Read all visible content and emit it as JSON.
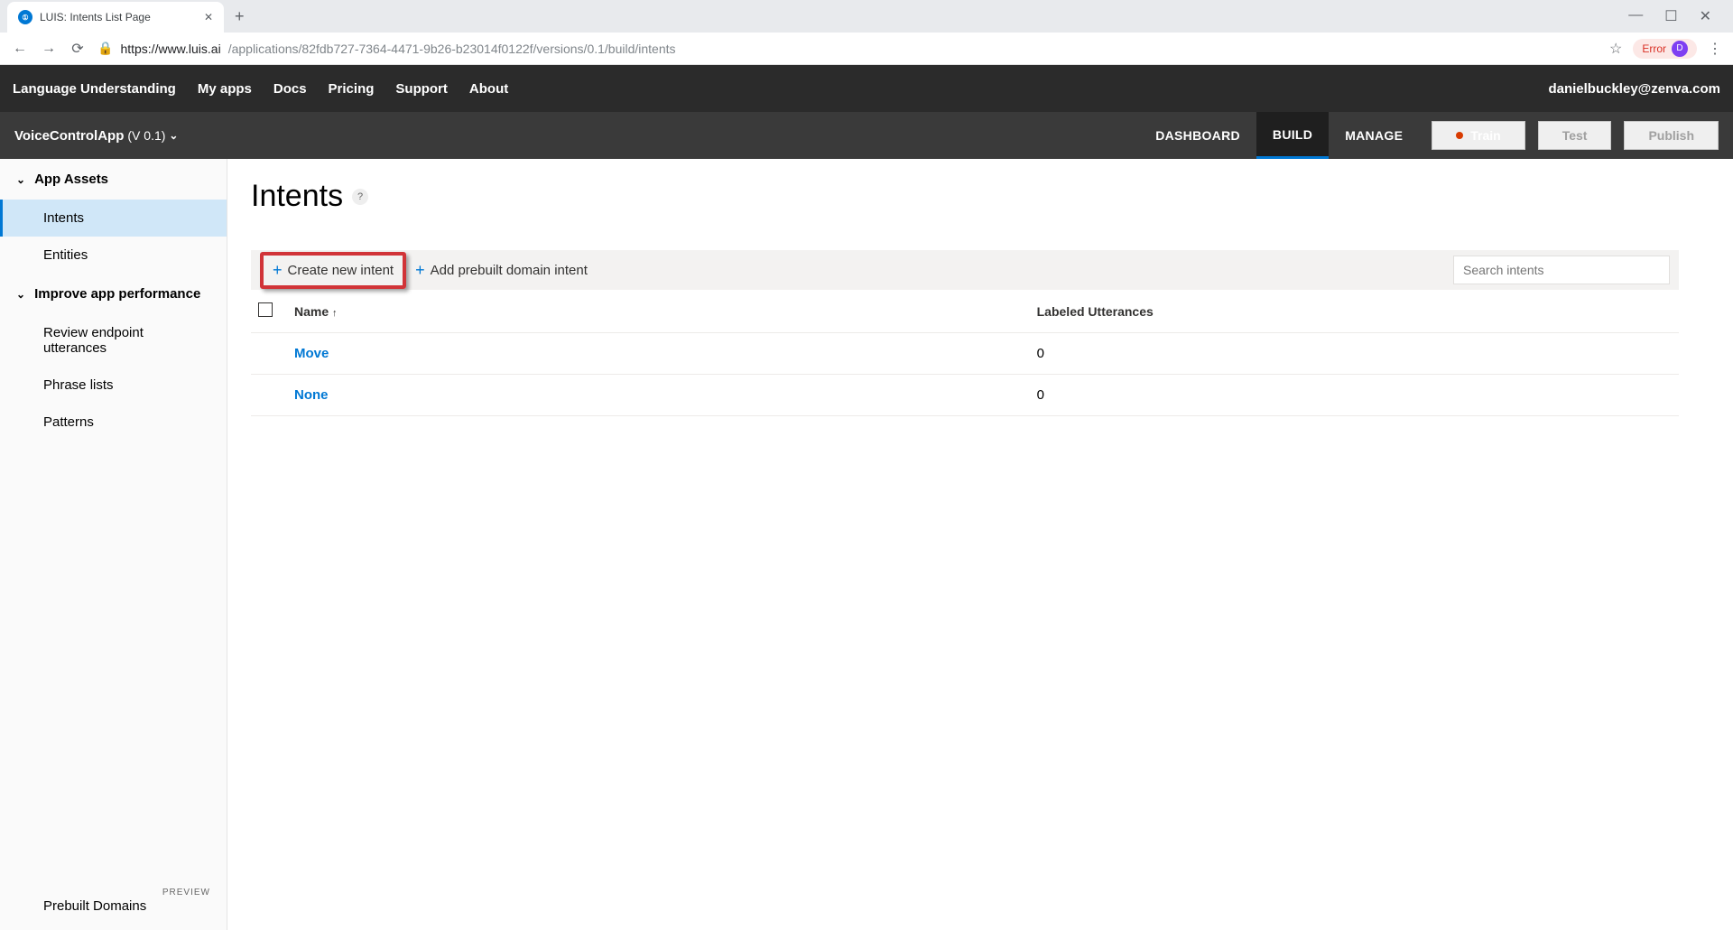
{
  "browser": {
    "tab_title": "LUIS: Intents List Page",
    "url_host": "https://www.luis.ai",
    "url_path": "/applications/82fdb727-7364-4471-9b26-b23014f0122f/versions/0.1/build/intents",
    "error_badge": "Error",
    "avatar_letter": "D"
  },
  "topnav": {
    "brand": "Language Understanding",
    "links": [
      "My apps",
      "Docs",
      "Pricing",
      "Support",
      "About"
    ],
    "user_email": "danielbuckley@zenva.com"
  },
  "subnav": {
    "app_name": "VoiceControlApp",
    "app_version": "(V 0.1)",
    "tabs": [
      "DASHBOARD",
      "BUILD",
      "MANAGE"
    ],
    "active_tab": "BUILD",
    "train_label": "Train",
    "test_label": "Test",
    "publish_label": "Publish"
  },
  "sidebar": {
    "group1": "App Assets",
    "items1": [
      "Intents",
      "Entities"
    ],
    "group2": "Improve app performance",
    "items2": [
      "Review endpoint utterances",
      "Phrase lists",
      "Patterns"
    ],
    "footer": "Prebuilt Domains",
    "preview": "PREVIEW"
  },
  "main": {
    "title": "Intents",
    "help": "?",
    "create_btn": "Create new intent",
    "prebuilt_btn": "Add prebuilt domain intent",
    "search_placeholder": "Search intents",
    "col_name": "Name",
    "col_utterances": "Labeled Utterances",
    "rows": [
      {
        "name": "Move",
        "utterances": "0"
      },
      {
        "name": "None",
        "utterances": "0"
      }
    ]
  }
}
